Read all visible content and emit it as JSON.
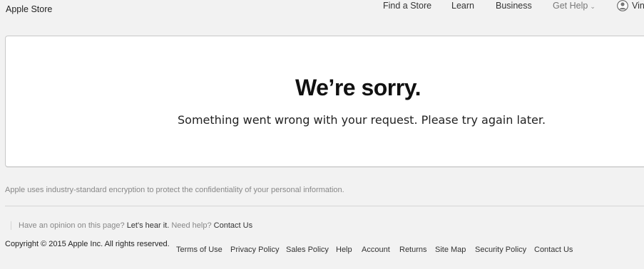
{
  "header": {
    "brand": "Apple Store",
    "nav": [
      {
        "label": "Find a Store"
      },
      {
        "label": "Learn"
      },
      {
        "label": "Business"
      },
      {
        "label": "Get Help"
      }
    ],
    "user_name": "Vin"
  },
  "error": {
    "title": "We’re sorry.",
    "message": "Something went wrong with your request. Please try again later."
  },
  "footer": {
    "security_note": "Apple uses industry-standard encryption to protect the confidentiality of your personal information.",
    "feedback_prompt": "Have an opinion on this page?",
    "feedback_link": "Let's hear it.",
    "help_prompt": "Need help?",
    "contact_link": "Contact Us",
    "copyright": "Copyright © 2015 Apple Inc. All rights reserved.",
    "links": [
      "Terms of Use",
      "Privacy Policy",
      "Sales Policy",
      "Help",
      "Account",
      "Returns",
      "Site Map",
      "Security Policy",
      "Contact Us"
    ]
  }
}
